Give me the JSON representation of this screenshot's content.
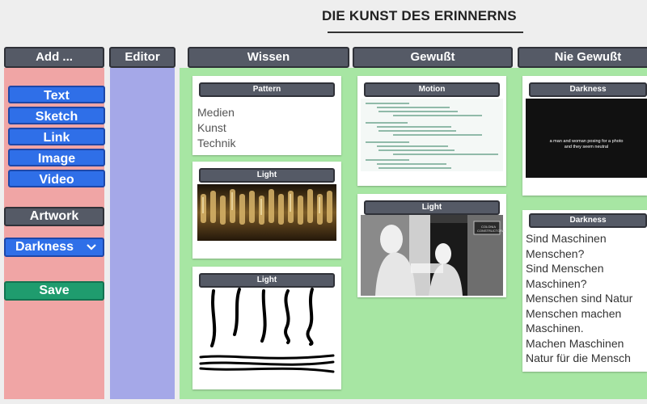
{
  "app": {
    "title": "DIE KUNST DES ERINNERNS"
  },
  "columns": {
    "add": "Add ...",
    "editor": "Editor",
    "wissen": "Wissen",
    "gewusst": "Gewußt",
    "nie_gewusst": "Nie Gewußt"
  },
  "add_panel": {
    "buttons": [
      "Text",
      "Sketch",
      "Link",
      "Image",
      "Video"
    ],
    "artwork_label": "Artwork",
    "artwork_selected": "Darkness",
    "save_label": "Save"
  },
  "cards": {
    "pattern": {
      "label": "Pattern",
      "lines": [
        "Medien",
        "Kunst",
        "Technik"
      ]
    },
    "light_wissen_1": {
      "label": "Light"
    },
    "light_wissen_2": {
      "label": "Light"
    },
    "motion": {
      "label": "Motion"
    },
    "light_gewusst": {
      "label": "Light",
      "sign_text": "COLONIA CONSTRUCTORA"
    },
    "darkness_image": {
      "label": "Darkness",
      "caption_line1": "a man and woman posing for a photo",
      "caption_line2": "and they seem neutral"
    },
    "darkness_text": {
      "label": "Darkness",
      "lines": [
        "Sind Maschinen",
        "Menschen?",
        "Sind Menschen",
        "Maschinen?",
        "Menschen sind Natur",
        "Menschen machen",
        "Maschinen.",
        "Machen Maschinen",
        "Natur für die Mensch"
      ]
    }
  },
  "icons": {
    "select_chevron": "chevron-down-icon"
  },
  "colors": {
    "add_column": "#f0a5a5",
    "editor_column": "#a5a8e8",
    "board_column": "#a7e6a3",
    "button_blue": "#2f6fe8",
    "button_save": "#1f9c6e",
    "header": "#555a66"
  }
}
